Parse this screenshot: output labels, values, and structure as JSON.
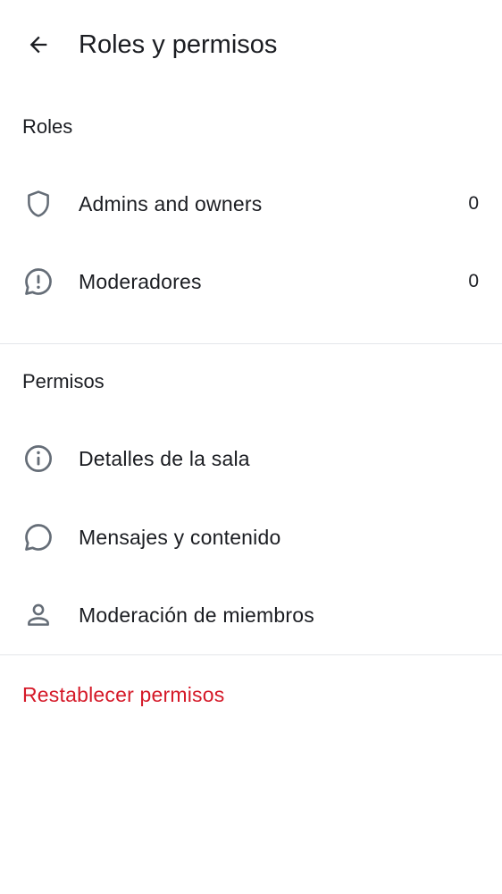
{
  "header": {
    "back_icon": "arrow-left-icon",
    "title": "Roles y permisos"
  },
  "roles": {
    "heading": "Roles",
    "items": [
      {
        "icon": "shield-icon",
        "label": "Admins and owners",
        "count": "0"
      },
      {
        "icon": "alert-bubble-icon",
        "label": "Moderadores",
        "count": "0"
      }
    ]
  },
  "permissions": {
    "heading": "Permisos",
    "items": [
      {
        "icon": "info-icon",
        "label": "Detalles de la sala"
      },
      {
        "icon": "chat-bubble-icon",
        "label": "Mensajes y contenido"
      },
      {
        "icon": "person-icon",
        "label": "Moderación de miembros"
      }
    ]
  },
  "reset": {
    "label": "Restablecer permisos"
  },
  "colors": {
    "text": "#1b1d22",
    "icon": "#656d77",
    "divider": "#e4e6ea",
    "danger": "#d51928",
    "background": "#ffffff"
  }
}
